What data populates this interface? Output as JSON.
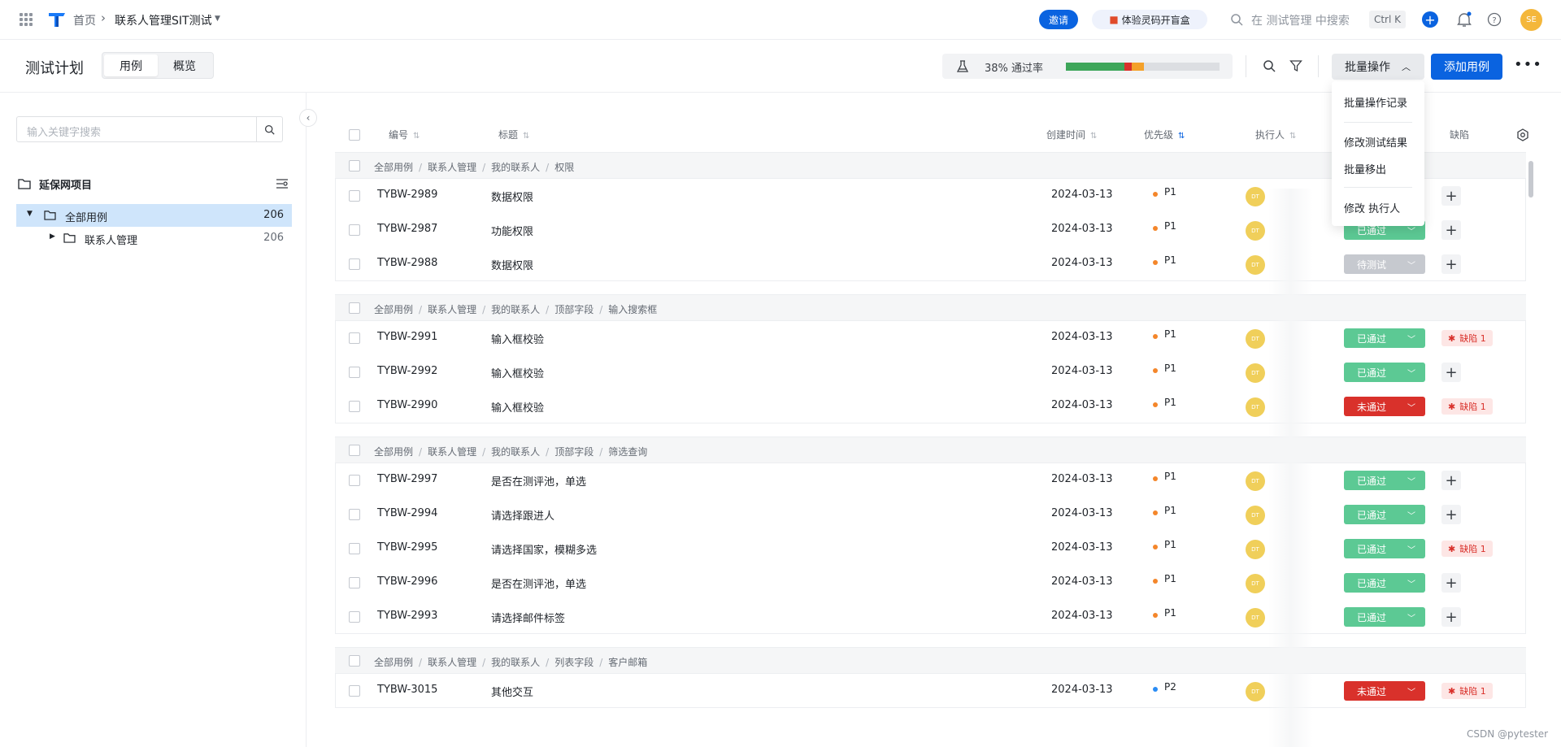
{
  "nav": {
    "home": "首页",
    "project": "联系人管理SIT测试",
    "invite": "邀请",
    "promo": "体验灵码开盲盒",
    "search_placeholder": "在 测试管理 中搜索",
    "shortcut": "Ctrl K",
    "avatar": "SE"
  },
  "page": {
    "title": "测试计划",
    "tabs": [
      "用例",
      "概览"
    ],
    "pass_rate": "38% 通过率",
    "pass_breakdown": {
      "passed": 0.38,
      "failed": 0.05,
      "blocked": 0.08,
      "untested": 0.49
    },
    "bulk_label": "批量操作",
    "add_label": "添加用例"
  },
  "dropdown": {
    "items": [
      "批量操作记录",
      "修改测试结果",
      "批量移出",
      "修改 执行人"
    ]
  },
  "sidebar": {
    "search_placeholder": "输入关键字搜索",
    "project": "延保网项目",
    "tree": [
      {
        "label": "全部用例",
        "count": "206"
      },
      {
        "label": "联系人管理",
        "count": "206"
      }
    ]
  },
  "table": {
    "headers": {
      "id": "编号",
      "title": "标题",
      "created": "创建时间",
      "priority": "优先级",
      "executor": "执行人",
      "defect": "缺陷"
    },
    "groups": [
      {
        "path": [
          "全部用例",
          "联系人管理",
          "我的联系人",
          "权限"
        ],
        "rows": [
          {
            "id": "TYBW-2989",
            "title": "数据权限",
            "date": "2024-03-13",
            "priority": "P1",
            "status": "",
            "status_type": "hidden",
            "defect": ""
          },
          {
            "id": "TYBW-2987",
            "title": "功能权限",
            "date": "2024-03-13",
            "priority": "P1",
            "status": "已通过",
            "status_type": "pass",
            "defect": ""
          },
          {
            "id": "TYBW-2988",
            "title": "数据权限",
            "date": "2024-03-13",
            "priority": "P1",
            "status": "待测试",
            "status_type": "wait",
            "defect": ""
          }
        ]
      },
      {
        "path": [
          "全部用例",
          "联系人管理",
          "我的联系人",
          "顶部字段",
          "输入搜索框"
        ],
        "rows": [
          {
            "id": "TYBW-2991",
            "title": "输入框校验",
            "date": "2024-03-13",
            "priority": "P1",
            "status": "已通过",
            "status_type": "pass",
            "defect": "缺陷 1"
          },
          {
            "id": "TYBW-2992",
            "title": "输入框校验",
            "date": "2024-03-13",
            "priority": "P1",
            "status": "已通过",
            "status_type": "pass",
            "defect": ""
          },
          {
            "id": "TYBW-2990",
            "title": "输入框校验",
            "date": "2024-03-13",
            "priority": "P1",
            "status": "未通过",
            "status_type": "fail",
            "defect": "缺陷 1"
          }
        ]
      },
      {
        "path": [
          "全部用例",
          "联系人管理",
          "我的联系人",
          "顶部字段",
          "筛选查询"
        ],
        "rows": [
          {
            "id": "TYBW-2997",
            "title": "是否在测评池，单选",
            "date": "2024-03-13",
            "priority": "P1",
            "status": "已通过",
            "status_type": "pass",
            "defect": ""
          },
          {
            "id": "TYBW-2994",
            "title": "请选择跟进人",
            "date": "2024-03-13",
            "priority": "P1",
            "status": "已通过",
            "status_type": "pass",
            "defect": ""
          },
          {
            "id": "TYBW-2995",
            "title": "请选择国家，模糊多选",
            "date": "2024-03-13",
            "priority": "P1",
            "status": "已通过",
            "status_type": "pass",
            "defect": "缺陷 1"
          },
          {
            "id": "TYBW-2996",
            "title": "是否在测评池，单选",
            "date": "2024-03-13",
            "priority": "P1",
            "status": "已通过",
            "status_type": "pass",
            "defect": ""
          },
          {
            "id": "TYBW-2993",
            "title": "请选择邮件标签",
            "date": "2024-03-13",
            "priority": "P1",
            "status": "已通过",
            "status_type": "pass",
            "defect": ""
          }
        ]
      },
      {
        "path": [
          "全部用例",
          "联系人管理",
          "我的联系人",
          "列表字段",
          "客户邮箱"
        ],
        "rows": [
          {
            "id": "TYBW-3015",
            "title": "其他交互",
            "date": "2024-03-13",
            "priority": "P2",
            "status": "未通过",
            "status_type": "fail",
            "defect": "缺陷 1"
          }
        ]
      }
    ]
  },
  "watermark": "CSDN @pytester",
  "colors": {
    "accent": "#0a63e0",
    "pass": "#5cc994",
    "fail": "#d9312b",
    "wait": "#c6c9cf",
    "p1": "#f4862a",
    "p2": "#2a8cf4"
  }
}
